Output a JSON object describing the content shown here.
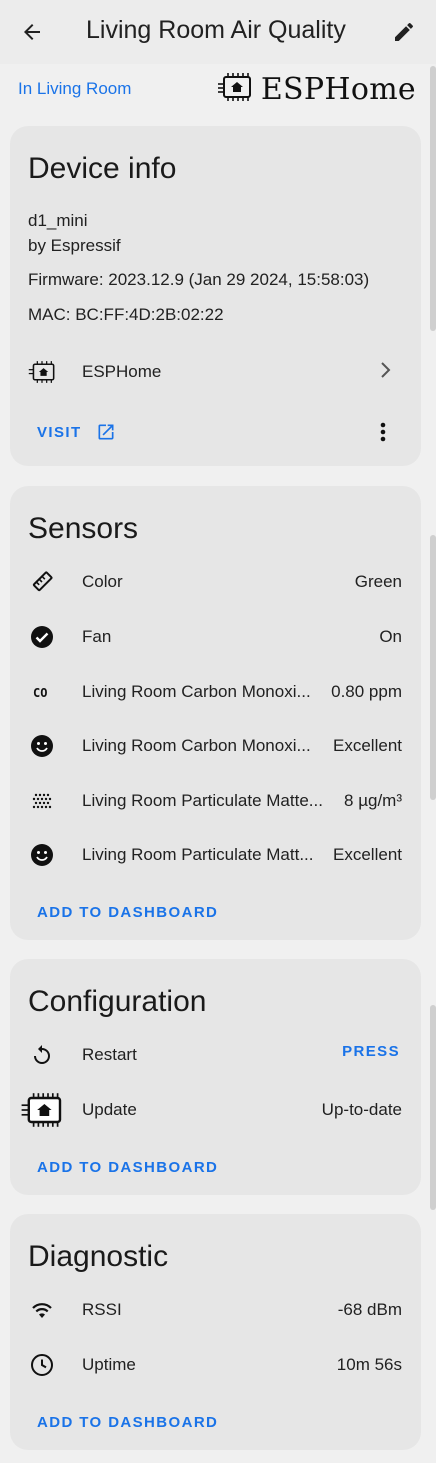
{
  "header": {
    "title": "Living Room Air Quality",
    "back_icon": "arrow-left-icon",
    "edit_icon": "pencil-icon"
  },
  "area_link": "In Living Room",
  "brand": {
    "name": "ESPHome"
  },
  "device_info": {
    "title": "Device info",
    "model": "d1_mini",
    "manufacturer": "by Espressif",
    "firmware": "Firmware: 2023.12.9 (Jan 29 2024, 15:58:03)",
    "mac": "MAC: BC:FF:4D:2B:02:22",
    "integration": "ESPHome",
    "visit_label": "VISIT"
  },
  "sensors": {
    "title": "Sensors",
    "items": [
      {
        "name": "Color",
        "value": "Green",
        "icon": "eyedropper-icon"
      },
      {
        "name": "Fan",
        "value": "On",
        "icon": "check-circle-icon"
      },
      {
        "name": "Living Room Carbon Monoxi...",
        "value": "0.80 ppm",
        "icon": "co-icon"
      },
      {
        "name": "Living Room Carbon Monoxi...",
        "value": "Excellent",
        "icon": "smiley-icon"
      },
      {
        "name": "Living Room Particulate Matte...",
        "value": "8 µg/m³",
        "icon": "dots-grid-icon"
      },
      {
        "name": "Living Room Particulate Matt...",
        "value": "Excellent",
        "icon": "smiley-icon"
      }
    ],
    "add_label": "ADD TO DASHBOARD"
  },
  "configuration": {
    "title": "Configuration",
    "restart": {
      "name": "Restart",
      "action": "PRESS",
      "icon": "restart-icon"
    },
    "update": {
      "name": "Update",
      "value": "Up-to-date",
      "icon": "esphome-icon"
    },
    "add_label": "ADD TO DASHBOARD"
  },
  "diagnostic": {
    "title": "Diagnostic",
    "items": [
      {
        "name": "RSSI",
        "value": "-68 dBm",
        "icon": "wifi-icon"
      },
      {
        "name": "Uptime",
        "value": "10m 56s",
        "icon": "clock-icon"
      }
    ],
    "add_label": "ADD TO DASHBOARD"
  },
  "colors": {
    "accent": "#1a73e8",
    "card": "#e6e6e6",
    "background": "#f0f0f0"
  }
}
